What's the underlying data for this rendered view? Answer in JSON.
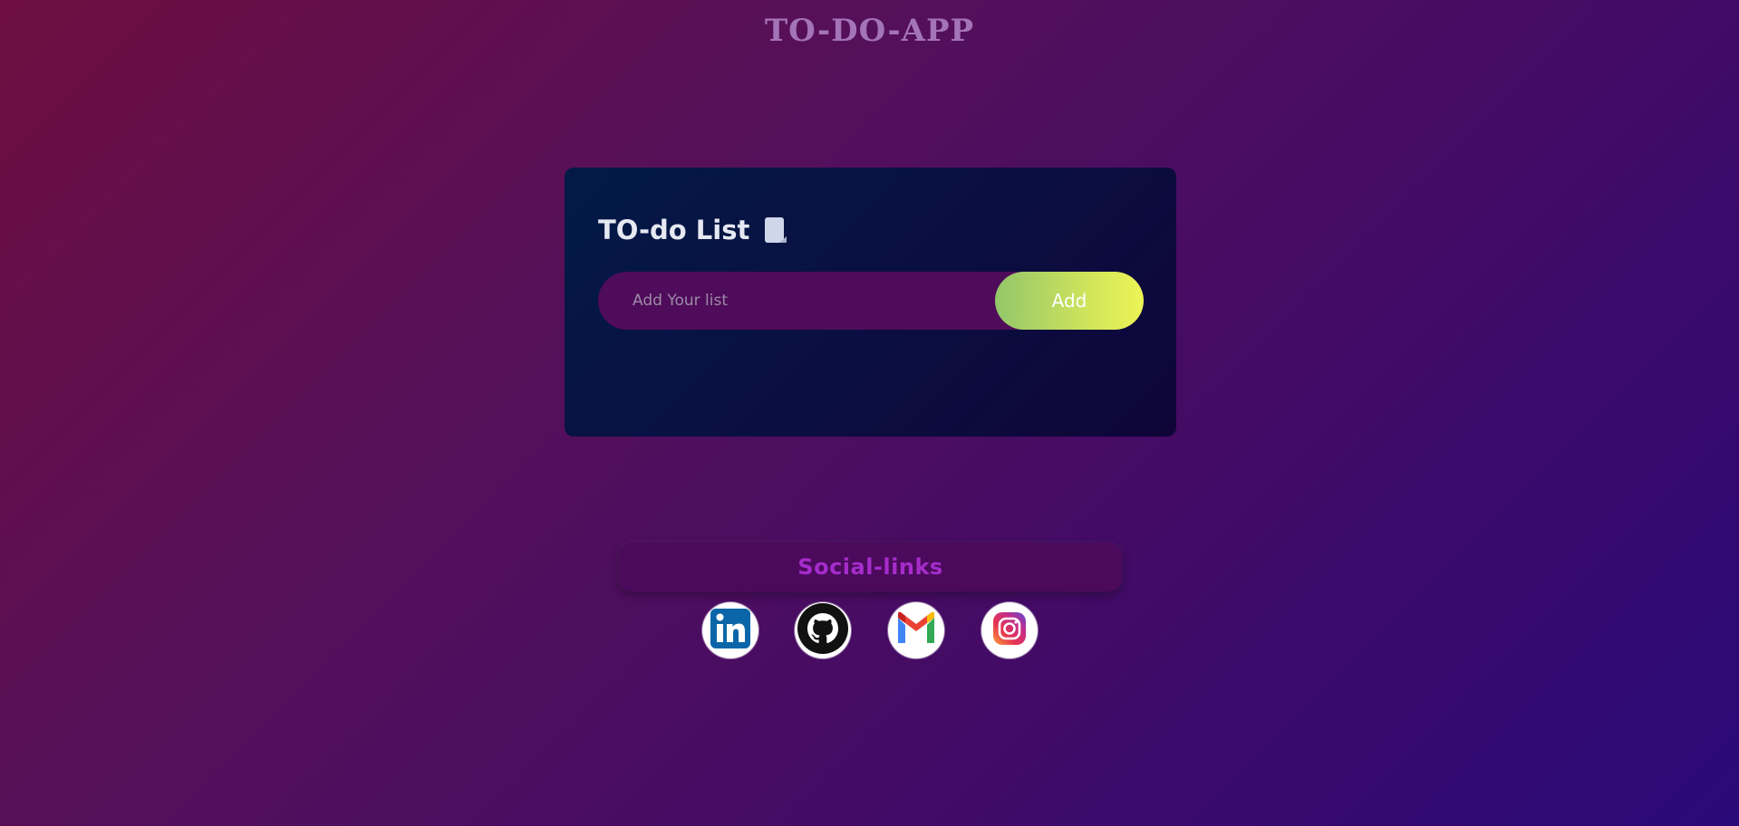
{
  "app": {
    "title": "TO-DO-APP"
  },
  "todo": {
    "heading": "TO-do List",
    "heading_icon": "note-icon",
    "input_placeholder": "Add Your list",
    "input_value": "",
    "add_label": "Add"
  },
  "social": {
    "title": "Social-links",
    "links": [
      {
        "icon": "linkedin-icon"
      },
      {
        "icon": "github-icon"
      },
      {
        "icon": "gmail-icon"
      },
      {
        "icon": "instagram-icon"
      }
    ]
  },
  "colors": {
    "app_title": "#a474b8",
    "card_bg": "#031a46",
    "input_bg": "#4f0c5a",
    "add_gradient_start": "#93c66a",
    "add_gradient_end": "#ecf455",
    "social_title": "#a52ccb"
  }
}
